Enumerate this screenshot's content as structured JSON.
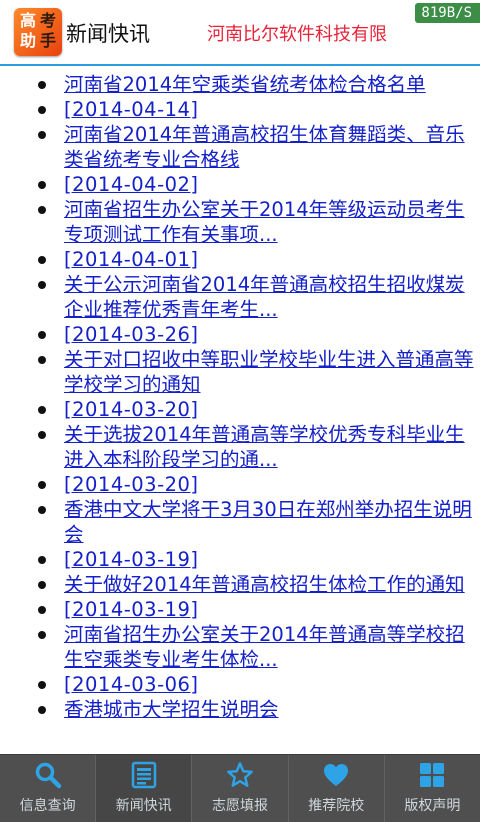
{
  "header": {
    "logo_chars": [
      "高",
      "考",
      "助",
      "手"
    ],
    "title": "新闻快讯",
    "company": "河南比尔软件科技有限"
  },
  "status_bar": {
    "network_speed": "819B/S",
    "wifi_icon": "wifi-icon"
  },
  "news": [
    {
      "text": "河南省2014年空乘类省统考体检合格名单",
      "date": "[2014-04-14]"
    },
    {
      "text": "河南省2014年普通高校招生体育舞蹈类、音乐类省统考专业合格线",
      "date": "[2014-04-02]"
    },
    {
      "text": "河南省招生办公室关于2014年等级运动员考生专项测试工作有关事项...",
      "date": "[2014-04-01]"
    },
    {
      "text": "关于公示河南省2014年普通高校招生招收煤炭企业推荐优秀青年考生...",
      "date": "[2014-03-26]"
    },
    {
      "text": "关于对口招收中等职业学校毕业生进入普通高等学校学习的通知",
      "date": "[2014-03-20]"
    },
    {
      "text": "关于选拔2014年普通高等学校优秀专科毕业生进入本科阶段学习的通...",
      "date": "[2014-03-20]"
    },
    {
      "text": "香港中文大学将于3月30日在郑州举办招生说明会",
      "date": "[2014-03-19]"
    },
    {
      "text": "关于做好2014年普通高校招生体检工作的通知",
      "date": "[2014-03-19]"
    },
    {
      "text": "河南省招生办公室关于2014年普通高等学校招生空乘类专业考生体检...",
      "date": "[2014-03-06]"
    },
    {
      "text": "香港城市大学招生说明会",
      "date": ""
    }
  ],
  "tabs": [
    {
      "label": "信息查询",
      "icon": "search-icon"
    },
    {
      "label": "新闻快讯",
      "icon": "news-icon"
    },
    {
      "label": "志愿填报",
      "icon": "star-icon"
    },
    {
      "label": "推荐院校",
      "icon": "heart-icon"
    },
    {
      "label": "版权声明",
      "icon": "grid-icon"
    }
  ],
  "colors": {
    "accent": "#2a9fe0",
    "link": "#1420c8",
    "company": "#e8243a",
    "tab_icon": "#2ea3e6",
    "tabbar": "#4f4f4f"
  }
}
